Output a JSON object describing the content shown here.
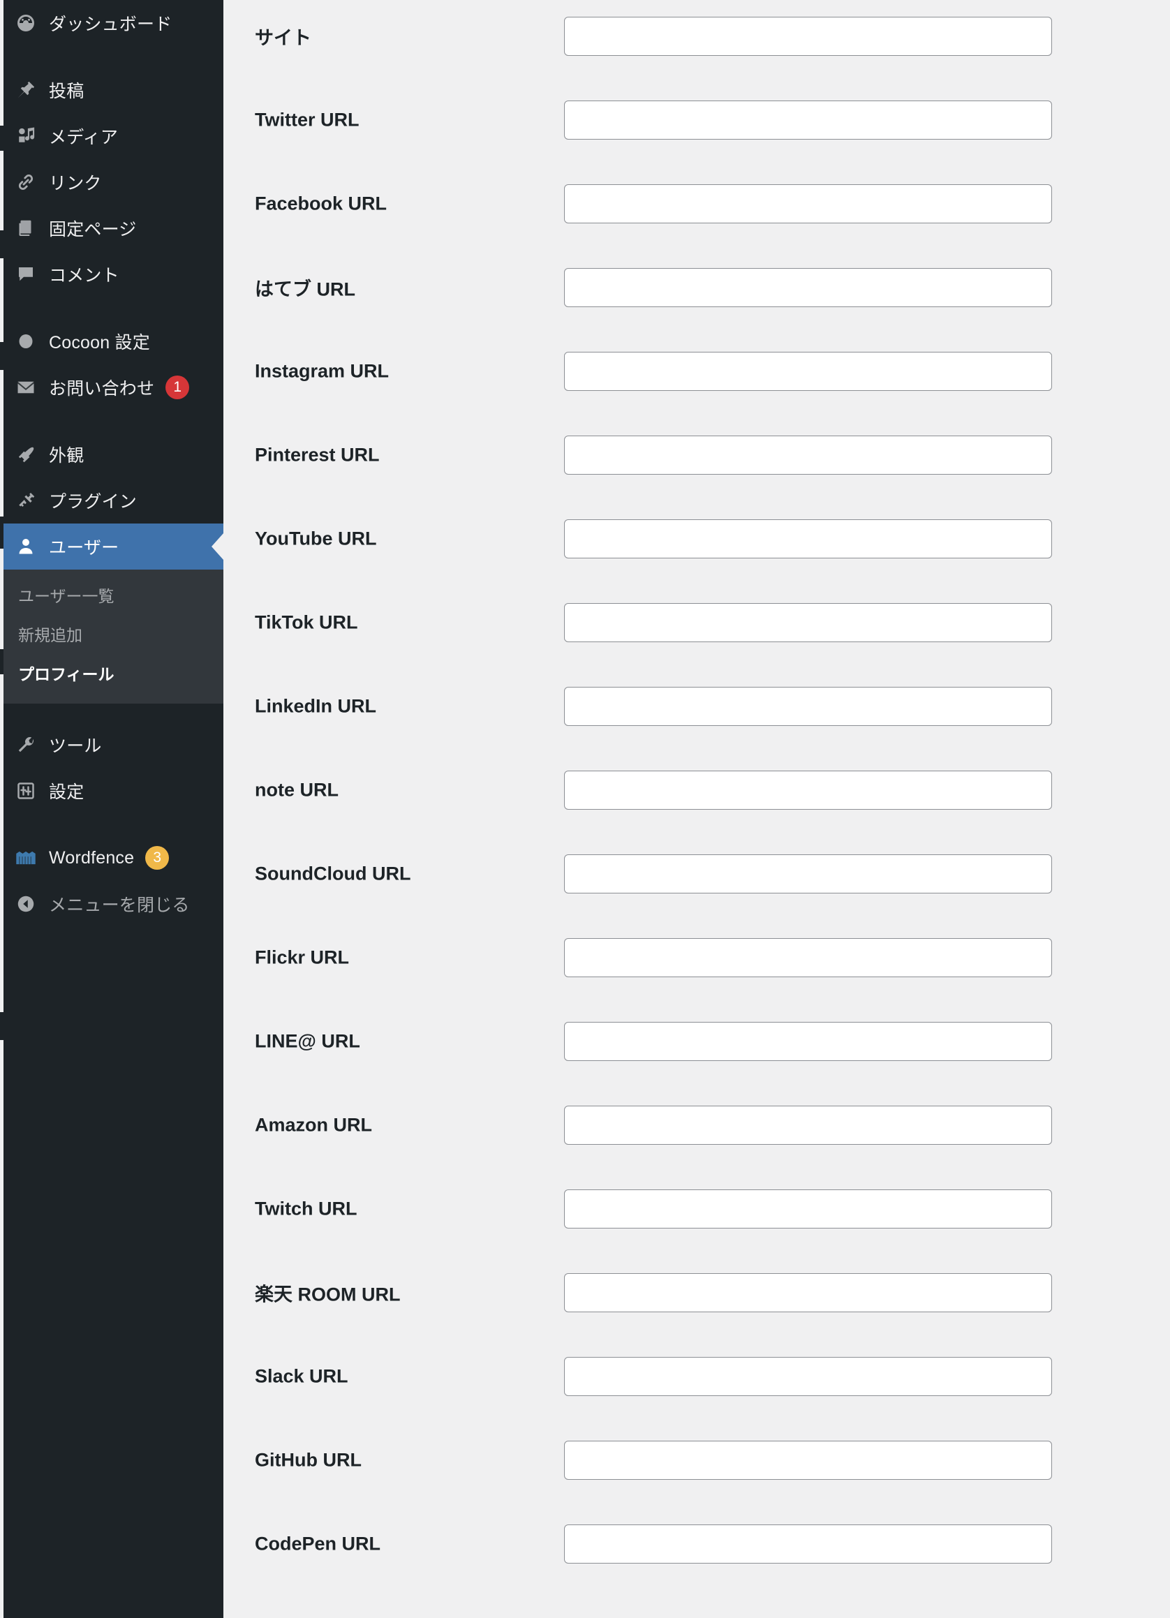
{
  "sidebar": {
    "groups": [
      {
        "items": [
          {
            "label": "ダッシュボード",
            "icon": "dashboard-icon",
            "active": false
          }
        ]
      },
      {
        "items": [
          {
            "label": "投稿",
            "icon": "posts-pin-icon",
            "active": false
          },
          {
            "label": "メディア",
            "icon": "media-icon",
            "active": false
          },
          {
            "label": "リンク",
            "icon": "links-chain-icon",
            "active": false
          },
          {
            "label": "固定ページ",
            "icon": "pages-icon",
            "active": false
          },
          {
            "label": "コメント",
            "icon": "comments-bubble-icon",
            "active": false
          }
        ]
      },
      {
        "items": [
          {
            "label": "Cocoon 設定",
            "icon": "cocoon-circle-icon",
            "active": false
          },
          {
            "label": "お問い合わせ",
            "icon": "mail-envelope-icon",
            "active": false,
            "badge": "1",
            "badge_color": "#d63638"
          }
        ]
      },
      {
        "items": [
          {
            "label": "外観",
            "icon": "appearance-brush-icon",
            "active": false
          },
          {
            "label": "プラグイン",
            "icon": "plugins-plug-icon",
            "active": false
          },
          {
            "label": "ユーザー",
            "icon": "users-person-icon",
            "active": true
          }
        ]
      },
      {
        "items": [
          {
            "label": "ツール",
            "icon": "tools-wrench-icon",
            "active": false
          },
          {
            "label": "設定",
            "icon": "settings-sliders-icon",
            "active": false
          }
        ]
      },
      {
        "items": [
          {
            "label": "Wordfence",
            "icon": "wordfence-castle-icon",
            "active": false,
            "badge": "3",
            "badge_color": "#f0b849"
          }
        ]
      },
      {
        "items": [
          {
            "label": "メニューを閉じる",
            "icon": "collapse-menu-icon",
            "active": false
          }
        ]
      }
    ],
    "submenu": [
      {
        "label": "ユーザー一覧",
        "current": false
      },
      {
        "label": "新規追加",
        "current": false
      },
      {
        "label": "プロフィール",
        "current": true
      }
    ],
    "colors": {
      "background": "#1d2327",
      "submenu_background": "#32373c",
      "active": "#3f72ab",
      "text": "#f0f0f1",
      "muted_text": "#a7aaad"
    }
  },
  "form": {
    "background": "#f0f0f1",
    "input_border": "#8c8f94",
    "input_background": "#ffffff",
    "fields": [
      {
        "label": "サイト",
        "value": "",
        "placeholder": ""
      },
      {
        "label": "Twitter URL",
        "value": "",
        "placeholder": ""
      },
      {
        "label": "Facebook URL",
        "value": "",
        "placeholder": ""
      },
      {
        "label": "はてブ URL",
        "value": "",
        "placeholder": ""
      },
      {
        "label": "Instagram URL",
        "value": "",
        "placeholder": ""
      },
      {
        "label": "Pinterest URL",
        "value": "",
        "placeholder": ""
      },
      {
        "label": "YouTube URL",
        "value": "",
        "placeholder": ""
      },
      {
        "label": "TikTok URL",
        "value": "",
        "placeholder": ""
      },
      {
        "label": "LinkedIn URL",
        "value": "",
        "placeholder": ""
      },
      {
        "label": "note URL",
        "value": "",
        "placeholder": ""
      },
      {
        "label": "SoundCloud URL",
        "value": "",
        "placeholder": ""
      },
      {
        "label": "Flickr URL",
        "value": "",
        "placeholder": ""
      },
      {
        "label": "LINE@ URL",
        "value": "",
        "placeholder": ""
      },
      {
        "label": "Amazon URL",
        "value": "",
        "placeholder": ""
      },
      {
        "label": "Twitch URL",
        "value": "",
        "placeholder": ""
      },
      {
        "label": "楽天 ROOM URL",
        "value": "",
        "placeholder": ""
      },
      {
        "label": "Slack URL",
        "value": "",
        "placeholder": ""
      },
      {
        "label": "GitHub URL",
        "value": "",
        "placeholder": ""
      },
      {
        "label": "CodePen URL",
        "value": "",
        "placeholder": ""
      }
    ]
  }
}
